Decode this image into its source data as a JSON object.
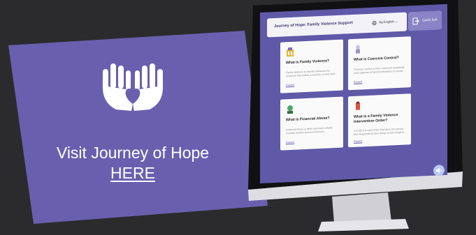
{
  "promo": {
    "text": "Visit Journey of Hope ",
    "link_label": "HERE"
  },
  "app": {
    "title": "Journey of Hope: Family Violence Support",
    "language": "Ag English ⌄",
    "exit_label": "Quick Exit"
  },
  "cards": [
    {
      "title": "What is Family Violence?",
      "desc": "Family violence is harmful behaviour by someone that makes a member of their fami...",
      "link": "Expand"
    },
    {
      "title": "What is Coercive Control?",
      "desc": "Coercive control is when someone repeatedly uses patterns of harmful behaviour to comtp...",
      "link": "Expand"
    },
    {
      "title": "What is Financial Abuse?",
      "desc": "Financial abuse is when someone unfairly controls another person's finances...",
      "link": "Expand"
    },
    {
      "title": "What is a Family Violence Intervention Order?",
      "desc": "A FVIO is a court order that bans one person (the Respondent) from doing certain things to...",
      "link": "Expand"
    }
  ],
  "colors": {
    "banner": "#6a5fae",
    "background": "#2b2b2d",
    "screen": "#5f59a8"
  }
}
